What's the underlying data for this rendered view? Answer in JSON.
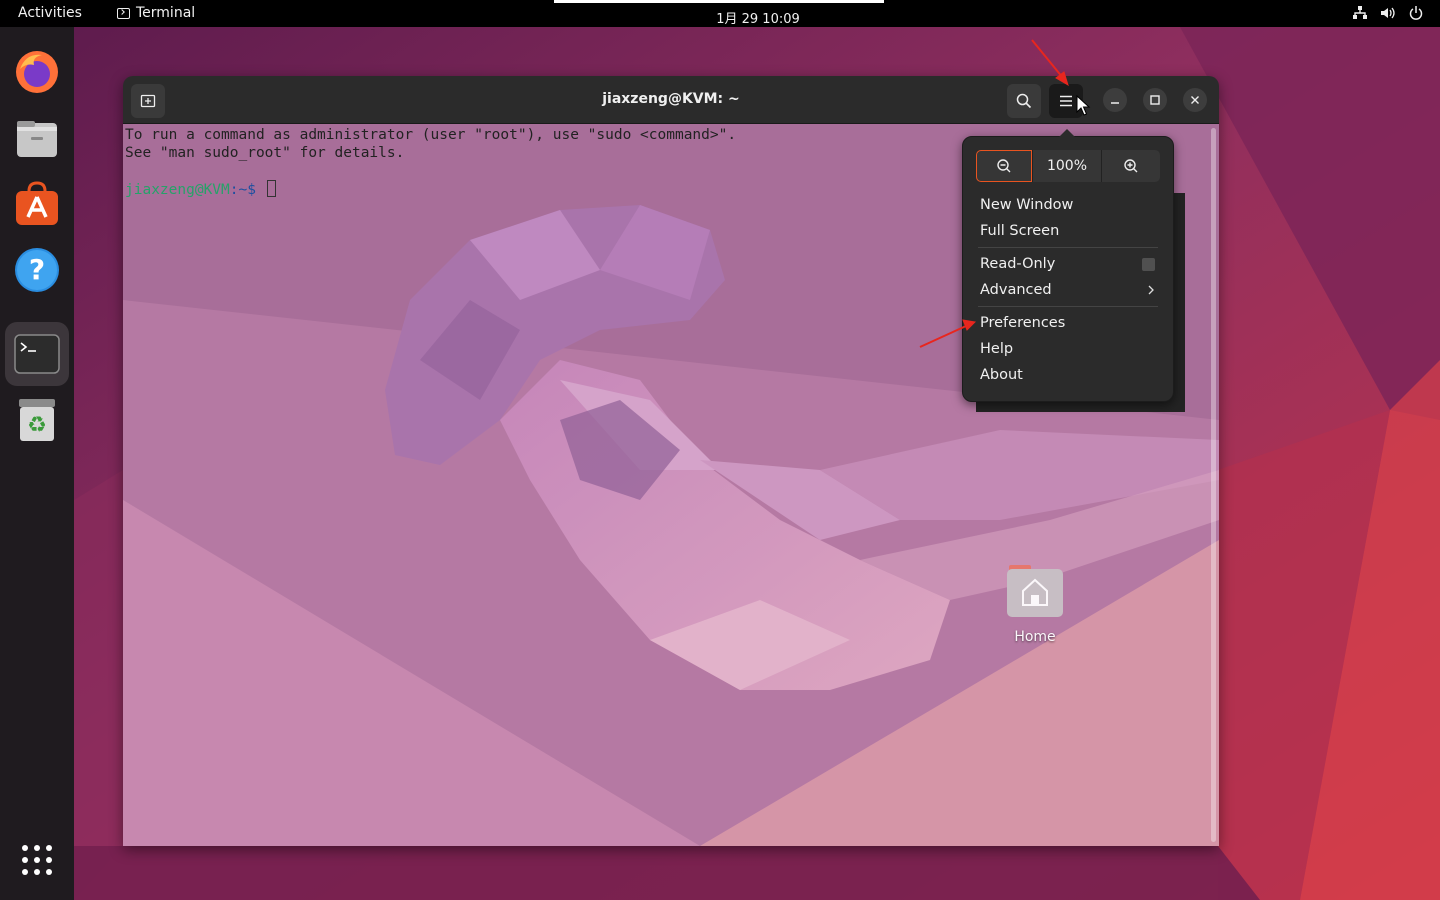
{
  "topbar": {
    "activities": "Activities",
    "app_name": "Terminal",
    "clock": "1月 29  10:09"
  },
  "dock": {
    "items": [
      "firefox-icon",
      "files-icon",
      "app-center-icon",
      "help-icon",
      "terminal-icon",
      "trash-icon",
      "show-apps-icon"
    ]
  },
  "terminal": {
    "title": "jiaxzeng@KVM: ~",
    "lines": [
      "To run a command as administrator (user \"root\"), use \"sudo <command>\".",
      "See \"man sudo_root\" for details."
    ],
    "prompt_user": "jiaxzeng@KVM",
    "prompt_path": ":~$ "
  },
  "menu": {
    "zoom_value": "100%",
    "items": [
      {
        "label": "New Window"
      },
      {
        "label": "Full Screen"
      },
      {
        "label": "Read-Only"
      },
      {
        "label": "Advanced"
      },
      {
        "label": "Preferences"
      },
      {
        "label": "Help"
      },
      {
        "label": "About"
      }
    ]
  },
  "desktop": {
    "home_label": "Home"
  },
  "colors": {
    "accent": "#e95420",
    "annotation": "#e8261e"
  }
}
